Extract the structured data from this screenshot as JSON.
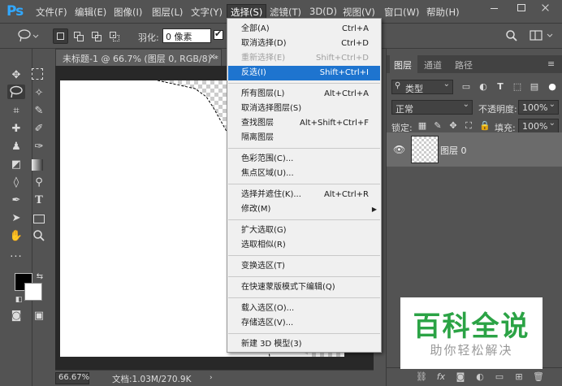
{
  "app": {
    "logo": "Ps"
  },
  "menubar": {
    "items": [
      "文件(F)",
      "编辑(E)",
      "图像(I)",
      "图层(L)",
      "文字(Y)",
      "选择(S)",
      "滤镜(T)",
      "3D(D)",
      "视图(V)",
      "窗口(W)",
      "帮助(H)"
    ],
    "active_index": 5
  },
  "options": {
    "feather_label": "羽化:",
    "feather_value": "0 像素"
  },
  "document": {
    "tab_title": "未标题-1 @ 66.7% (图层 0, RGB/8) *",
    "tab_close": "×",
    "zoom": "66.67%",
    "doc_info": "文档:1.03M/270.9K",
    "status_arrow": "›"
  },
  "select_menu": {
    "items": [
      {
        "label": "全部(A)",
        "shortcut": "Ctrl+A"
      },
      {
        "label": "取消选择(D)",
        "shortcut": "Ctrl+D"
      },
      {
        "label": "重新选择(E)",
        "shortcut": "Shift+Ctrl+D",
        "disabled": true
      },
      {
        "label": "反选(I)",
        "shortcut": "Shift+Ctrl+I",
        "highlighted": true
      },
      {
        "label": "所有图层(L)",
        "shortcut": "Alt+Ctrl+A"
      },
      {
        "label": "取消选择图层(S)",
        "shortcut": ""
      },
      {
        "label": "查找图层",
        "shortcut": "Alt+Shift+Ctrl+F"
      },
      {
        "label": "隔离图层",
        "shortcut": ""
      },
      {
        "label": "色彩范围(C)...",
        "shortcut": ""
      },
      {
        "label": "焦点区域(U)...",
        "shortcut": ""
      },
      {
        "label": "选择并遮住(K)...",
        "shortcut": "Alt+Ctrl+R"
      },
      {
        "label": "修改(M)",
        "shortcut": ""
      },
      {
        "label": "扩大选取(G)",
        "shortcut": ""
      },
      {
        "label": "选取相似(R)",
        "shortcut": ""
      },
      {
        "label": "变换选区(T)",
        "shortcut": ""
      },
      {
        "label": "在快速蒙版模式下编辑(Q)",
        "shortcut": ""
      },
      {
        "label": "载入选区(O)...",
        "shortcut": ""
      },
      {
        "label": "存储选区(V)...",
        "shortcut": ""
      },
      {
        "label": "新建 3D 模型(3)",
        "shortcut": ""
      }
    ]
  },
  "layers_panel": {
    "tabs": [
      "图层",
      "通道",
      "路径"
    ],
    "filter_kind": "类型",
    "blend_mode": "正常",
    "opacity_label": "不透明度:",
    "opacity_value": "100%",
    "lock_label": "锁定:",
    "fill_label": "填充:",
    "fill_value": "100%",
    "layer_name": "图层 0"
  },
  "watermark": {
    "title": "百科全说",
    "subtitle": "助你轻松解决"
  },
  "colors": {
    "accent_blue": "#1e74cf",
    "ps_blue": "#31a8ff",
    "watermark_green": "#2ba345"
  }
}
